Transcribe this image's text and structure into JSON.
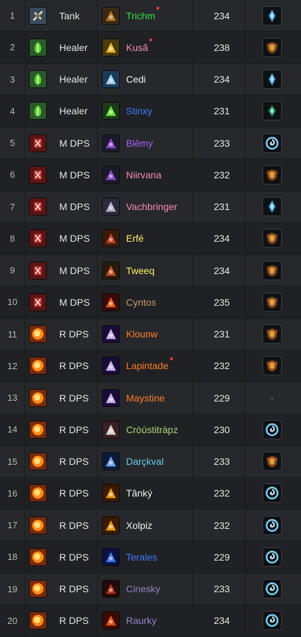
{
  "colors": {
    "green": "#32e34a",
    "pink": "#f58cba",
    "white": "#f2f2f2",
    "blue": "#3d7bff",
    "purple": "#a562ff",
    "orange": "#ff7d2a",
    "yellow": "#fff468",
    "brown": "#c69b6d",
    "lime": "#abd473",
    "cyan": "#69ccf0",
    "lavender": "#9482c9"
  },
  "rows": [
    {
      "num": "1",
      "role": "Tank",
      "role_icon": "tank-icon",
      "spec_icon": "druid-guardian-icon",
      "name": "Trichm",
      "name_color": "green",
      "dot": true,
      "ilvl": "234",
      "cov": "kyrian-covenant-icon"
    },
    {
      "num": "2",
      "role": "Healer",
      "role_icon": "healer-icon",
      "spec_icon": "paladin-holy-icon",
      "name": "Kusã",
      "name_color": "pink",
      "dot": true,
      "ilvl": "238",
      "cov": "venthyr-covenant-icon"
    },
    {
      "num": "3",
      "role": "Healer",
      "role_icon": "healer-icon",
      "spec_icon": "priest-discipline-icon",
      "name": "Cedi",
      "name_color": "white",
      "dot": false,
      "ilvl": "234",
      "cov": "kyrian-covenant-icon"
    },
    {
      "num": "4",
      "role": "Healer",
      "role_icon": "healer-icon",
      "spec_icon": "shaman-restoration-icon",
      "name": "Stinxy",
      "name_color": "blue",
      "dot": false,
      "ilvl": "231",
      "cov": "necrolord-covenant-icon"
    },
    {
      "num": "5",
      "role": "M DPS",
      "role_icon": "melee-dps-icon",
      "spec_icon": "demon-hunter-icon",
      "name": "Blêmy",
      "name_color": "purple",
      "dot": false,
      "ilvl": "233",
      "cov": "nightfae-covenant-icon"
    },
    {
      "num": "6",
      "role": "M DPS",
      "role_icon": "melee-dps-icon",
      "spec_icon": "demon-hunter-icon",
      "name": "Niirvana",
      "name_color": "pink",
      "dot": false,
      "ilvl": "232",
      "cov": "venthyr-covenant-icon"
    },
    {
      "num": "7",
      "role": "M DPS",
      "role_icon": "melee-dps-icon",
      "spec_icon": "paladin-retribution-icon",
      "name": "Vachbringer",
      "name_color": "pink",
      "dot": false,
      "ilvl": "231",
      "cov": "kyrian-covenant-icon"
    },
    {
      "num": "8",
      "role": "M DPS",
      "role_icon": "melee-dps-icon",
      "spec_icon": "warrior-arms-icon",
      "name": "Erfé",
      "name_color": "yellow",
      "dot": false,
      "ilvl": "234",
      "cov": "venthyr-covenant-icon"
    },
    {
      "num": "9",
      "role": "M DPS",
      "role_icon": "melee-dps-icon",
      "spec_icon": "rogue-icon",
      "name": "Tweeq",
      "name_color": "yellow",
      "dot": false,
      "ilvl": "234",
      "cov": "venthyr-covenant-icon"
    },
    {
      "num": "10",
      "role": "M DPS",
      "role_icon": "melee-dps-icon",
      "spec_icon": "warrior-fury-icon",
      "name": "Cyntos",
      "name_color": "brown",
      "dot": false,
      "ilvl": "235",
      "cov": "venthyr-covenant-icon"
    },
    {
      "num": "11",
      "role": "R DPS",
      "role_icon": "ranged-dps-icon",
      "spec_icon": "mage-arcane-icon",
      "name": "Klounw",
      "name_color": "orange",
      "dot": false,
      "ilvl": "231",
      "cov": "venthyr-covenant-icon"
    },
    {
      "num": "12",
      "role": "R DPS",
      "role_icon": "ranged-dps-icon",
      "spec_icon": "mage-arcane-icon",
      "name": "Lapintade",
      "name_color": "orange",
      "dot": true,
      "ilvl": "232",
      "cov": "venthyr-covenant-icon"
    },
    {
      "num": "13",
      "role": "R DPS",
      "role_icon": "ranged-dps-icon",
      "spec_icon": "mage-arcane-icon",
      "name": "Maystine",
      "name_color": "orange",
      "dot": false,
      "ilvl": "229",
      "cov": "-"
    },
    {
      "num": "14",
      "role": "R DPS",
      "role_icon": "ranged-dps-icon",
      "spec_icon": "hunter-icon",
      "name": "Cròùstitràpz",
      "name_color": "lime",
      "dot": false,
      "ilvl": "230",
      "cov": "nightfae-covenant-icon"
    },
    {
      "num": "15",
      "role": "R DPS",
      "role_icon": "ranged-dps-icon",
      "spec_icon": "mage-frost-icon",
      "name": "Darçkval",
      "name_color": "cyan",
      "dot": false,
      "ilvl": "233",
      "cov": "venthyr-covenant-icon"
    },
    {
      "num": "16",
      "role": "R DPS",
      "role_icon": "ranged-dps-icon",
      "spec_icon": "warlock-icon",
      "name": "Tânký",
      "name_color": "white",
      "dot": false,
      "ilvl": "232",
      "cov": "nightfae-covenant-icon"
    },
    {
      "num": "17",
      "role": "R DPS",
      "role_icon": "ranged-dps-icon",
      "spec_icon": "warlock-icon",
      "name": "Xolpiz",
      "name_color": "white",
      "dot": false,
      "ilvl": "232",
      "cov": "nightfae-covenant-icon"
    },
    {
      "num": "18",
      "role": "R DPS",
      "role_icon": "ranged-dps-icon",
      "spec_icon": "shaman-elemental-icon",
      "name": "Terales",
      "name_color": "blue",
      "dot": false,
      "ilvl": "229",
      "cov": "nightfae-covenant-icon"
    },
    {
      "num": "19",
      "role": "R DPS",
      "role_icon": "ranged-dps-icon",
      "spec_icon": "warlock-demonology-icon",
      "name": "Cinesky",
      "name_color": "lavender",
      "dot": false,
      "ilvl": "233",
      "cov": "nightfae-covenant-icon"
    },
    {
      "num": "20",
      "role": "R DPS",
      "role_icon": "ranged-dps-icon",
      "spec_icon": "warlock-destruction-icon",
      "name": "Raurky",
      "name_color": "lavender",
      "dot": false,
      "ilvl": "234",
      "cov": "nightfae-covenant-icon"
    }
  ]
}
